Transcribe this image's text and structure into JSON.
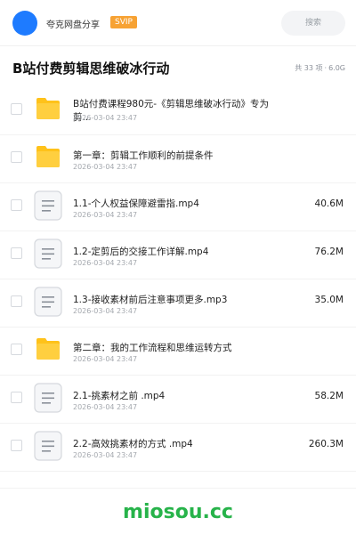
{
  "header": {
    "share_name": "夸克网盘分享",
    "badge": "SVIP",
    "search_placeholder": "搜索"
  },
  "folder": {
    "title": "B站付费剪辑思维破冰行动",
    "count": "共 33 项",
    "size": "6.0G"
  },
  "files": [
    {
      "type": "folder",
      "name": "B站付费课程980元-《剪辑思维破冰行动》专为剪...",
      "date": "2026-03-04 23:47",
      "size": ""
    },
    {
      "type": "folder",
      "name": "第一章：剪辑工作顺利的前提条件",
      "date": "2026-03-04 23:47",
      "size": ""
    },
    {
      "type": "file",
      "name": "1.1-个人权益保障避雷指.mp4",
      "date": "2026-03-04 23:47",
      "size": "40.6M"
    },
    {
      "type": "file",
      "name": "1.2-定剪后的交接工作详解.mp4",
      "date": "2026-03-04 23:47",
      "size": "76.2M"
    },
    {
      "type": "file",
      "name": "1.3-接收素材前后注意事项更多.mp3",
      "date": "2026-03-04 23:47",
      "size": "35.0M"
    },
    {
      "type": "folder",
      "name": "第二章：我的工作流程和思维运转方式",
      "date": "2026-03-04 23:47",
      "size": ""
    },
    {
      "type": "file",
      "name": "2.1-挑素材之前 .mp4",
      "date": "2026-03-04 23:47",
      "size": "58.2M"
    },
    {
      "type": "file",
      "name": "2.2-高效挑素材的方式 .mp4",
      "date": "2026-03-04 23:47",
      "size": "260.3M"
    }
  ],
  "watermark": "miosou.cc",
  "colors": {
    "avatar": "#1e7bff",
    "svip_badge": "#f7a233",
    "folder_icon": "#ffc21a",
    "watermark": "#27b34a"
  }
}
